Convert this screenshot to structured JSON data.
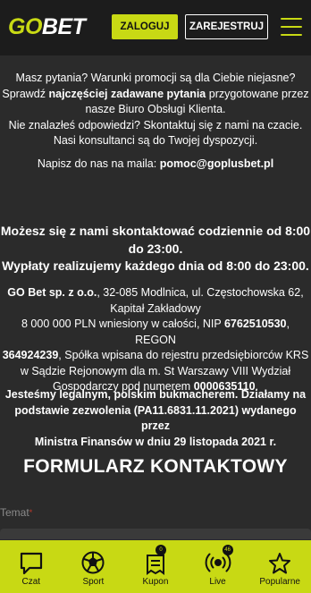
{
  "header": {
    "logo_go": "GO",
    "logo_bet": "BET",
    "login_label": "ZALOGUJ",
    "register_label": "ZAREJESTRUJ"
  },
  "info": {
    "line1": "Masz pytania? Warunki promocji są dla Ciebie niejasne?",
    "line2_pre": "Sprawdź ",
    "line2_link": "najczęściej zadawane pytania",
    "line2_post": " przygotowane przez",
    "line3": "nasze Biuro Obsługi Klienta.",
    "line4": "Nie znalazłeś odpowiedzi? Skontaktuj się z nami na czacie.",
    "line5": "Nasi konsultanci są do Twojej dyspozycji."
  },
  "email": {
    "prefix": "Napisz do nas na maila: ",
    "address": "pomoc@goplusbet.pl"
  },
  "hours": {
    "line1": "Możesz się z nami skontaktować codziennie od 8:00",
    "line2": "do 23:00.",
    "line3": "Wypłaty realizujemy każdego dnia od 8:00 do 23:00."
  },
  "company": {
    "name": "GO Bet sp. z o.o.",
    "address": ", 32-085 Modlnica, ul. Częstochowska 62,",
    "line2": "Kapitał Zakładowy",
    "line3_pre": "8 000 000 PLN wniesiony w całości, NIP ",
    "nip": "6762510530",
    "line3_mid": ", REGON",
    "regon": "364924239",
    "line4_post": ", Spółka wpisana do rejestru przedsiębiorców KRS",
    "line5": "w Sądzie Rejonowym dla m. St Warszawy VIII Wydział",
    "line6_pre": "Gospodarczy pod numerem ",
    "krs": "0000635110",
    "line6_post": "."
  },
  "legal": {
    "line1": "Jesteśmy legalnym, polskim bukmacherem. Działamy na",
    "line2": "podstawie zezwolenia (PA11.6831.11.2021) wydanego przez",
    "line3": "Ministra Finansów w dniu 29 listopada 2021 r."
  },
  "form": {
    "title": "FORMULARZ KONTAKTOWY",
    "subject_label": "Temat",
    "required_mark": "*"
  },
  "bottom_nav": {
    "chat": "Czat",
    "sport": "Sport",
    "coupon": "Kupon",
    "coupon_badge": "0",
    "live": "Live",
    "live_badge": "46",
    "popular": "Popularne"
  },
  "colors": {
    "accent": "#c8d914",
    "background": "#2b2b2b",
    "header": "#1c1c1c"
  }
}
